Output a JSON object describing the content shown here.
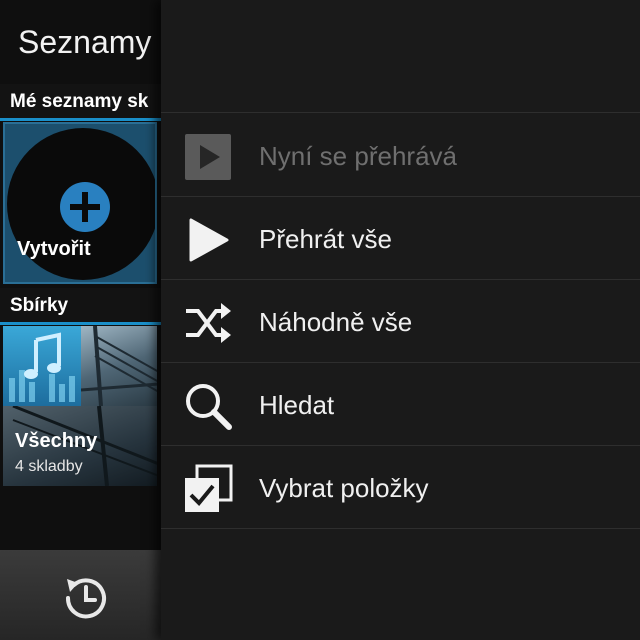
{
  "app": {
    "title": "Seznamy"
  },
  "sections": {
    "my_playlists": "Mé seznamy sk",
    "collections": "Sbírky"
  },
  "tiles": {
    "create_label": "Vytvořit",
    "all": {
      "name": "Všechny",
      "count": "4 skladby"
    }
  },
  "bottom_bar": {
    "history_icon": "history-clock-icon"
  },
  "menu": {
    "items": [
      {
        "label": "Nyní se přehrává",
        "icon": "now-playing-icon",
        "enabled": false
      },
      {
        "label": "Přehrát vše",
        "icon": "play-icon",
        "enabled": true
      },
      {
        "label": "Náhodně vše",
        "icon": "shuffle-icon",
        "enabled": true
      },
      {
        "label": "Hledat",
        "icon": "search-icon",
        "enabled": true
      },
      {
        "label": "Vybrat položky",
        "icon": "select-items-icon",
        "enabled": true
      }
    ]
  },
  "colors": {
    "accent": "#1a8fc9",
    "menu_background": "#1a1a1a",
    "disabled_text": "#6f6f6f"
  }
}
